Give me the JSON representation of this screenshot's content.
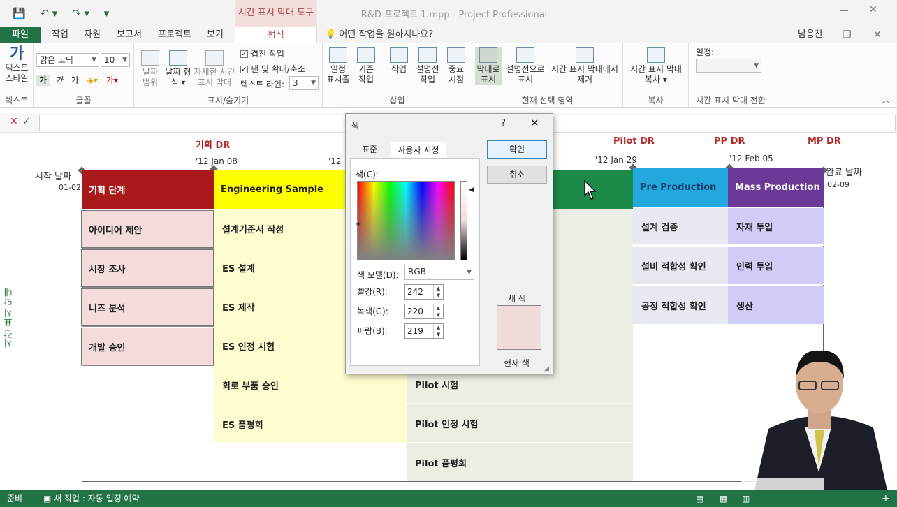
{
  "window": {
    "title": "R&D 프로젝트 1.mpp - Project Professional",
    "context_tab": "시간 표시 막대 도구",
    "controls": {
      "minimize": "ㅡ",
      "restore": "❐",
      "close": "✕"
    },
    "qat": {
      "save": "💾",
      "undo": "↶ ▾",
      "redo": "↷ ▾",
      "customize": "▾"
    }
  },
  "tabs": {
    "file": "파일",
    "task": "작업",
    "resource": "자원",
    "report": "보고서",
    "project": "프로젝트",
    "view": "보기",
    "format": "형식",
    "tell_me": "어떤 작업을 원하시나요?",
    "user": "남응찬"
  },
  "ribbon": {
    "text_group": {
      "text_styles": "텍스트 스타일",
      "label": "텍스트",
      "font_name": "맑은 고딕",
      "font_size": "10",
      "label_font": "글꼴"
    },
    "show_hide": {
      "date_range": "날짜 범위",
      "date_format": "날짜 형식 ▾",
      "detailed": "자세한 시간 표시 막대",
      "overlap": "겹친 작업",
      "pan_zoom": "팬 및 확대/축소",
      "text_lines_label": "텍스트 라인:",
      "text_lines_value": "3",
      "label": "표시/숨기기"
    },
    "insert": {
      "existing_tasks": "일정 표시줄",
      "existing_tasks2": "기존 작업",
      "task": "작업",
      "callout_task": "설명선 작업",
      "milestone": "중요 시점",
      "label": "삽입"
    },
    "current_selection": {
      "display_as_bar": "막대로 표시",
      "display_as_callout": "설명선으로 표시",
      "remove_from_timeline": "시간 표시 막대에서 제거",
      "label": "현재 선택 영역"
    },
    "copy": {
      "copy_timeline": "시간 표시 막대 복사 ▾",
      "label": "복사"
    },
    "timeline_switch": {
      "schedule_label": "일정:",
      "label": "시간 표시 막대 전환"
    }
  },
  "timeline": {
    "side_label": "시간 표시 막대",
    "start_label": "시작 날짜",
    "start_date": "01-02",
    "end_label": "완료 날짜",
    "end_date": "02-09",
    "milestones": [
      "기획 DR",
      "Pilot DR",
      "PP DR",
      "MP DR"
    ],
    "dates": [
      "'12 Jan 08",
      "'12",
      "'12 Jan 29",
      "'12 Feb 05"
    ],
    "phases": {
      "planning": {
        "name": "기획 단계",
        "color": "#a91b1b",
        "tasks": [
          "아이디어 제안",
          "시장 조사",
          "니즈 분석",
          "개발 승인"
        ]
      },
      "es": {
        "name": "Engineering Sample",
        "color": "#ffff00",
        "tasks": [
          "설계기준서 작성",
          "ES 설계",
          "ES 제작",
          "ES 인정 시험",
          "회로 부품 승인",
          "ES 품평회"
        ]
      },
      "pilot": {
        "color": "#1e8a4a",
        "tasks": [
          "Pilot 시험",
          "Pilot 인정 시험",
          "Pilot 품평회"
        ]
      },
      "pp": {
        "name": "Pre Production",
        "color": "#22a8dc",
        "tasks": [
          "설계 검증",
          "설비 적합성 확인",
          "공정 적합성 확인"
        ]
      },
      "mp": {
        "name": "Mass Production",
        "color": "#6a3a96",
        "tasks": [
          "자재 투입",
          "인력 투입",
          "생산"
        ]
      }
    }
  },
  "dialog": {
    "title": "색",
    "help": "?",
    "close": "✕",
    "tab_standard": "표준",
    "tab_custom": "사용자 지정",
    "colors_label": "색(C):",
    "color_model_label": "색 모델(D):",
    "color_model": "RGB",
    "red_label": "빨강(R):",
    "red": "242",
    "green_label": "녹색(G):",
    "green": "220",
    "blue_label": "파랑(B):",
    "blue": "219",
    "ok": "확인",
    "cancel": "취소",
    "new_label": "새 색",
    "current_label": "현재 색",
    "new_color": "#f2dcdb"
  },
  "status": {
    "ready": "준비",
    "new_tasks": "새 작업 : 자동 일정 예약"
  }
}
